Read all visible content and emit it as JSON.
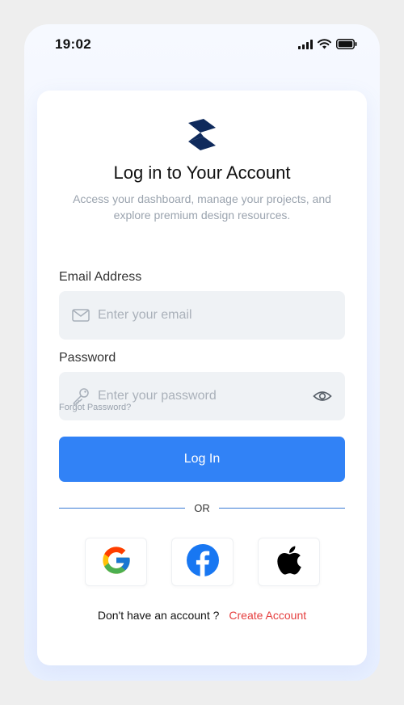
{
  "status_bar": {
    "time": "19:02"
  },
  "header": {
    "title": "Log in to Your Account",
    "subtitle": "Access your dashboard, manage your projects, and explore premium design resources."
  },
  "form": {
    "email_label": "Email Address",
    "email_placeholder": "Enter your email",
    "email_value": "",
    "password_label": "Password",
    "password_placeholder": "Enter your password",
    "password_value": "",
    "forgot_label": "Forgot Password?",
    "login_label": "Log In"
  },
  "divider": {
    "label": "OR"
  },
  "social": [
    {
      "name": "google",
      "icon": "google-icon"
    },
    {
      "name": "facebook",
      "icon": "facebook-icon"
    },
    {
      "name": "apple",
      "icon": "apple-icon"
    }
  ],
  "footer": {
    "question": "Don't have an account ?",
    "create_label": "Create Account"
  },
  "colors": {
    "primary": "#3182f6",
    "brand": "#0f2a5c",
    "link_red": "#e53e3e",
    "field_bg": "#eff2f5"
  }
}
